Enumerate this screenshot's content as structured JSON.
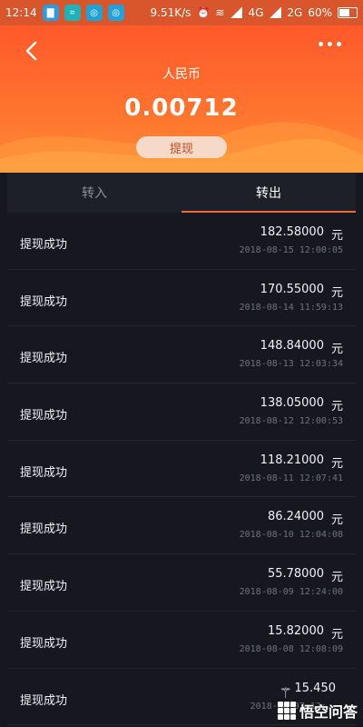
{
  "status_bar": {
    "time": "12:14",
    "network_speed": "9.51K/s",
    "signal_4g": "4G",
    "signal_2g": "2G",
    "battery": "60%"
  },
  "header": {
    "currency_label": "人民币",
    "balance": "0.00712",
    "withdraw_label": "提现"
  },
  "tabs": [
    {
      "label": "转入",
      "active": false
    },
    {
      "label": "转出",
      "active": true
    }
  ],
  "transactions": [
    {
      "title": "提现成功",
      "amount": "182.58000",
      "unit": "元",
      "time": "2018-08-15 12:00:05"
    },
    {
      "title": "提现成功",
      "amount": "170.55000",
      "unit": "元",
      "time": "2018-08-14 11:59:13"
    },
    {
      "title": "提现成功",
      "amount": "148.84000",
      "unit": "元",
      "time": "2018-08-13 12:03:34"
    },
    {
      "title": "提现成功",
      "amount": "138.05000",
      "unit": "元",
      "time": "2018-08-12 12:00:53"
    },
    {
      "title": "提现成功",
      "amount": "118.21000",
      "unit": "元",
      "time": "2018-08-11 12:07:41"
    },
    {
      "title": "提现成功",
      "amount": "86.24000",
      "unit": "元",
      "time": "2018-08-10 12:04:08"
    },
    {
      "title": "提现成功",
      "amount": "55.78000",
      "unit": "元",
      "time": "2018-08-09 12:24:00"
    },
    {
      "title": "提现成功",
      "amount": "15.82000",
      "unit": "元",
      "time": "2018-08-08 12:08:09"
    },
    {
      "title": "提现成功",
      "amount": "15.450",
      "unit": "",
      "time": "2018-08-07 12:..."
    }
  ],
  "watermark": {
    "text": "悟空问答"
  },
  "colors": {
    "accent": "#ff6a2d",
    "background": "#16171f",
    "tab_indicator": "#e66d36"
  }
}
